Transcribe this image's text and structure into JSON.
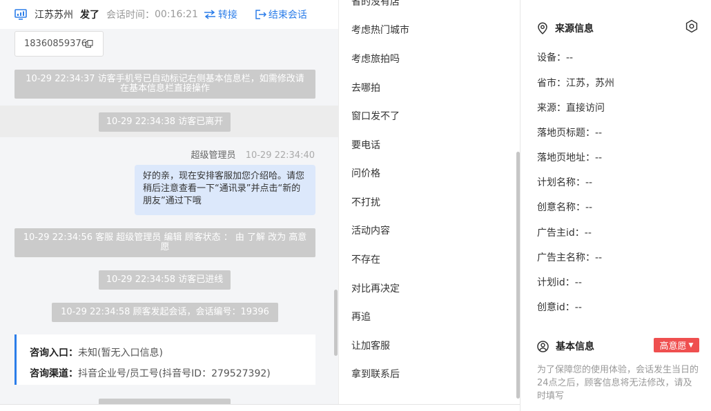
{
  "header": {
    "location": "江苏苏州",
    "title": "发了",
    "time_label": "会话时间：",
    "time_value": "00:16:21",
    "transfer_label": "转接",
    "end_label": "结束会话"
  },
  "chat": {
    "phone": "18360859376",
    "system_messages": [
      "10-29 22:34:37 访客手机号已自动标记右侧基本信息栏，如需修改请在基本信息栏直接操作",
      "10-29 22:34:38 访客已离开",
      "10-29 22:34:56 客服 超级管理员 编辑 顾客状态 ： 由 了解 改为 高意愿",
      "10-29 22:34:58 访客已进线",
      "10-29 22:34:58 顾客发起会话，会话编号：19396"
    ],
    "agent_name": "超级管理员",
    "agent_time": "10-29 22:34:40",
    "agent_message": "好的亲，现在安排客服加您介绍哈。请您稍后注意查看一下“通讯录”并点击“新的朋友”通过下哦",
    "source_card": {
      "entry_label": "咨询入口：",
      "entry_value": "未知(暂无入口信息)",
      "channel_label": "咨询渠道：",
      "channel_value": "抖音企业号/员工号(抖音号ID：279527392)"
    }
  },
  "quick_list": {
    "items": [
      "省的没有店",
      "考虑热门城市",
      "考虑旅拍吗",
      "去哪拍",
      "窗口发不了",
      "要电话",
      "问价格",
      "不打扰",
      "活动内容",
      "不存在",
      "对比再决定",
      "再追",
      "让加客服",
      "拿到联系后"
    ]
  },
  "info_panel": {
    "source_title": "来源信息",
    "fields": [
      {
        "label": "设备：",
        "value": "--"
      },
      {
        "label": "省市：",
        "value": "江苏，苏州"
      },
      {
        "label": "来源：",
        "value": "直接访问"
      },
      {
        "label": "落地页标题：",
        "value": "--"
      },
      {
        "label": "落地页地址：",
        "value": "--"
      },
      {
        "label": "计划名称：",
        "value": "--"
      },
      {
        "label": "创意名称：",
        "value": "--"
      },
      {
        "label": "广告主id：",
        "value": "--"
      },
      {
        "label": "广告主名称：",
        "value": "--"
      },
      {
        "label": "计划id：",
        "value": "--"
      },
      {
        "label": "创意id：",
        "value": "--"
      }
    ],
    "basic_title": "基本信息",
    "intent_label": "高意愿",
    "notice": "为了保障您的使用体验，会话发生当日的24点之后，顾客信息将无法修改，请及时填写"
  },
  "colors": {
    "accent": "#2b7de9",
    "intent": "#ef4f4f",
    "system_bubble": "#cbcbcb",
    "agent_bubble": "#dce8fb"
  },
  "icons": [
    "monitor-icon",
    "transfer-icon",
    "end-session-icon",
    "copy-icon",
    "location-pin-icon",
    "settings-icon",
    "user-circle-icon",
    "caret-down-icon"
  ]
}
